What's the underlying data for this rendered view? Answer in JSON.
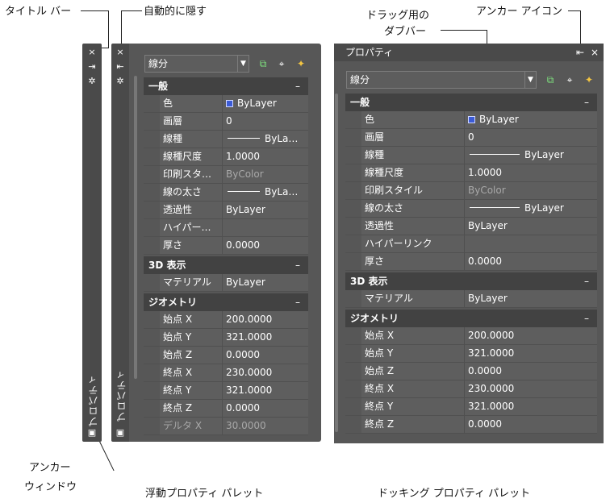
{
  "callouts": {
    "title_bar": "タイトル バー",
    "auto_hide": "自動的に隠す",
    "drag_bar_line1": "ドラッグ用の",
    "drag_bar_line2": "ダブバー",
    "anchor_icon": "アンカー アイコン",
    "anchor_window_line1": "アンカー",
    "anchor_window_line2": "ウィンドウ"
  },
  "captions": {
    "floating": "浮動プロパティ パレット",
    "docking": "ドッキング プロパティ パレット"
  },
  "palette_title": "プロパティ",
  "icons": {
    "close": "×",
    "anchor": "⇥",
    "settings": "✲",
    "dock_anchor": "⇤",
    "bottom_icon": "▣"
  },
  "colors": {
    "swatch": "#3b5bd6",
    "header": "#424242",
    "cell": "#5e5e5e"
  },
  "floating": {
    "object_type": "線分",
    "sections": [
      {
        "title": "一般",
        "toggle": "–",
        "rows": [
          {
            "label": "色",
            "value": "ByLayer"
          },
          {
            "label": "画層",
            "value": "0"
          },
          {
            "label": "線種",
            "value": "ByLa…"
          },
          {
            "label": "線種尺度",
            "value": "1.0000"
          },
          {
            "label": "印刷スタ…",
            "value": "ByColor"
          },
          {
            "label": "線の太さ",
            "value": "ByLa…"
          },
          {
            "label": "透過性",
            "value": "ByLayer"
          },
          {
            "label": "ハイパー…",
            "value": ""
          },
          {
            "label": "厚さ",
            "value": "0.0000"
          }
        ]
      },
      {
        "title": "3D 表示",
        "toggle": "–",
        "rows": [
          {
            "label": "マテリアル",
            "value": "ByLayer"
          }
        ]
      },
      {
        "title": "ジオメトリ",
        "toggle": "–",
        "rows": [
          {
            "label": "始点 X",
            "value": "200.0000"
          },
          {
            "label": "始点 Y",
            "value": "321.0000"
          },
          {
            "label": "始点 Z",
            "value": "0.0000"
          },
          {
            "label": "終点 X",
            "value": "230.0000"
          },
          {
            "label": "終点 Y",
            "value": "321.0000"
          },
          {
            "label": "終点 Z",
            "value": "0.0000"
          },
          {
            "label": "デルタ X",
            "value": "30.0000"
          }
        ]
      }
    ]
  },
  "docking": {
    "object_type": "線分",
    "sections": [
      {
        "title": "一般",
        "toggle": "–",
        "rows": [
          {
            "label": "色",
            "value": "ByLayer"
          },
          {
            "label": "画層",
            "value": "0"
          },
          {
            "label": "線種",
            "value": "ByLayer"
          },
          {
            "label": "線種尺度",
            "value": "1.0000"
          },
          {
            "label": "印刷スタイル",
            "value": "ByColor"
          },
          {
            "label": "線の太さ",
            "value": "ByLayer"
          },
          {
            "label": "透過性",
            "value": "ByLayer"
          },
          {
            "label": "ハイパーリンク",
            "value": ""
          },
          {
            "label": "厚さ",
            "value": "0.0000"
          }
        ]
      },
      {
        "title": "3D 表示",
        "toggle": "–",
        "rows": [
          {
            "label": "マテリアル",
            "value": "ByLayer"
          }
        ]
      },
      {
        "title": "ジオメトリ",
        "toggle": "–",
        "rows": [
          {
            "label": "始点 X",
            "value": "200.0000"
          },
          {
            "label": "始点 Y",
            "value": "321.0000"
          },
          {
            "label": "始点 Z",
            "value": "0.0000"
          },
          {
            "label": "終点 X",
            "value": "230.0000"
          },
          {
            "label": "終点 Y",
            "value": "321.0000"
          },
          {
            "label": "終点 Z",
            "value": "0.0000"
          }
        ]
      }
    ]
  }
}
